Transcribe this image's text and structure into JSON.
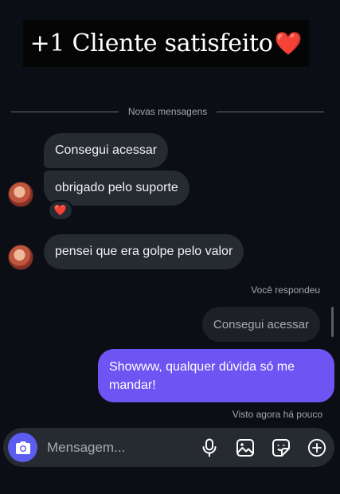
{
  "banner": {
    "text": "+1 Cliente satisfeito",
    "emoji": "❤️"
  },
  "divider": {
    "label": "Novas mensagens"
  },
  "messages": {
    "incoming": [
      {
        "text": "Consegui acessar"
      },
      {
        "text": "obrigado pelo suporte",
        "reaction": "❤️"
      },
      {
        "text": "pensei que era golpe pelo valor"
      }
    ],
    "replied_label": "Você respondeu",
    "replied_to": "Consegui acessar",
    "outgoing": {
      "text": "Showww, qualquer dúvida só me mandar!"
    },
    "seen_status": "Visto agora há pouco"
  },
  "composer": {
    "placeholder": "Mensagem...",
    "icons": [
      "camera-icon",
      "microphone-icon",
      "image-icon",
      "sticker-icon",
      "plus-icon"
    ]
  },
  "colors": {
    "background": "#0b0e14",
    "incoming_bubble": "#262a31",
    "outgoing_bubble": "#6e54f2",
    "camera_button": "#5b5cf0"
  }
}
